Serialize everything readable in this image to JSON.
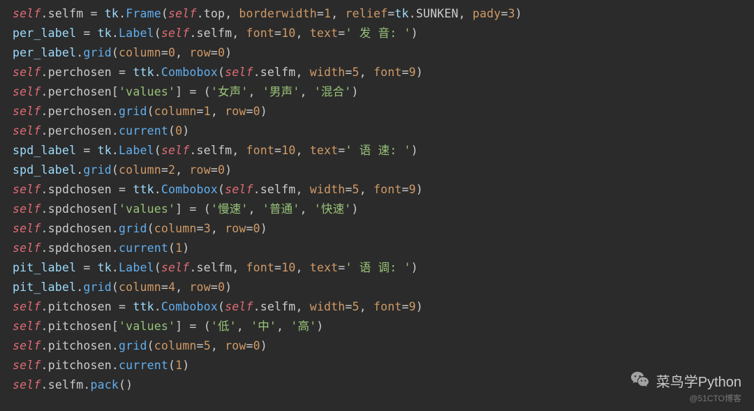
{
  "code_tokens": [
    [
      [
        "kw-self",
        "self"
      ],
      [
        "plain",
        "."
      ],
      [
        "plain",
        "selfm "
      ],
      [
        "op",
        "= "
      ],
      [
        "ident",
        "tk"
      ],
      [
        "plain",
        "."
      ],
      [
        "func",
        "Frame"
      ],
      [
        "plain",
        "("
      ],
      [
        "kw-self",
        "self"
      ],
      [
        "plain",
        "."
      ],
      [
        "plain",
        "top"
      ],
      [
        "plain",
        ", "
      ],
      [
        "gold-ident",
        "borderwidth"
      ],
      [
        "op",
        "="
      ],
      [
        "num",
        "1"
      ],
      [
        "plain",
        ", "
      ],
      [
        "gold-ident",
        "relief"
      ],
      [
        "op",
        "="
      ],
      [
        "ident",
        "tk"
      ],
      [
        "plain",
        "."
      ],
      [
        "plain",
        "SUNKEN"
      ],
      [
        "plain",
        ", "
      ],
      [
        "gold-ident",
        "pady"
      ],
      [
        "op",
        "="
      ],
      [
        "num",
        "3"
      ],
      [
        "plain",
        ")"
      ]
    ],
    [
      [
        "ident",
        "per_label "
      ],
      [
        "op",
        "= "
      ],
      [
        "ident",
        "tk"
      ],
      [
        "plain",
        "."
      ],
      [
        "func",
        "Label"
      ],
      [
        "plain",
        "("
      ],
      [
        "kw-self",
        "self"
      ],
      [
        "plain",
        "."
      ],
      [
        "plain",
        "selfm"
      ],
      [
        "plain",
        ", "
      ],
      [
        "gold-ident",
        "font"
      ],
      [
        "op",
        "="
      ],
      [
        "num",
        "10"
      ],
      [
        "plain",
        ", "
      ],
      [
        "gold-ident",
        "text"
      ],
      [
        "op",
        "="
      ],
      [
        "str",
        "' 发 音: '"
      ],
      [
        "plain",
        ")"
      ]
    ],
    [
      [
        "ident",
        "per_label"
      ],
      [
        "plain",
        "."
      ],
      [
        "func",
        "grid"
      ],
      [
        "plain",
        "("
      ],
      [
        "gold-ident",
        "column"
      ],
      [
        "op",
        "="
      ],
      [
        "num",
        "0"
      ],
      [
        "plain",
        ", "
      ],
      [
        "gold-ident",
        "row"
      ],
      [
        "op",
        "="
      ],
      [
        "num",
        "0"
      ],
      [
        "plain",
        ")"
      ]
    ],
    [
      [
        "kw-self",
        "self"
      ],
      [
        "plain",
        "."
      ],
      [
        "plain",
        "perchosen "
      ],
      [
        "op",
        "= "
      ],
      [
        "ident",
        "ttk"
      ],
      [
        "plain",
        "."
      ],
      [
        "func",
        "Combobox"
      ],
      [
        "plain",
        "("
      ],
      [
        "kw-self",
        "self"
      ],
      [
        "plain",
        "."
      ],
      [
        "plain",
        "selfm"
      ],
      [
        "plain",
        ", "
      ],
      [
        "gold-ident",
        "width"
      ],
      [
        "op",
        "="
      ],
      [
        "num",
        "5"
      ],
      [
        "plain",
        ", "
      ],
      [
        "gold-ident",
        "font"
      ],
      [
        "op",
        "="
      ],
      [
        "num",
        "9"
      ],
      [
        "plain",
        ")"
      ]
    ],
    [
      [
        "kw-self",
        "self"
      ],
      [
        "plain",
        "."
      ],
      [
        "plain",
        "perchosen"
      ],
      [
        "plain",
        "["
      ],
      [
        "str",
        "'values'"
      ],
      [
        "plain",
        "] "
      ],
      [
        "op",
        "= "
      ],
      [
        "plain",
        "("
      ],
      [
        "str",
        "'女声'"
      ],
      [
        "plain",
        ", "
      ],
      [
        "str",
        "'男声'"
      ],
      [
        "plain",
        ", "
      ],
      [
        "str",
        "'混合'"
      ],
      [
        "plain",
        ")"
      ]
    ],
    [
      [
        "kw-self",
        "self"
      ],
      [
        "plain",
        "."
      ],
      [
        "plain",
        "perchosen"
      ],
      [
        "plain",
        "."
      ],
      [
        "func",
        "grid"
      ],
      [
        "plain",
        "("
      ],
      [
        "gold-ident",
        "column"
      ],
      [
        "op",
        "="
      ],
      [
        "num",
        "1"
      ],
      [
        "plain",
        ", "
      ],
      [
        "gold-ident",
        "row"
      ],
      [
        "op",
        "="
      ],
      [
        "num",
        "0"
      ],
      [
        "plain",
        ")"
      ]
    ],
    [
      [
        "kw-self",
        "self"
      ],
      [
        "plain",
        "."
      ],
      [
        "plain",
        "perchosen"
      ],
      [
        "plain",
        "."
      ],
      [
        "func",
        "current"
      ],
      [
        "plain",
        "("
      ],
      [
        "num",
        "0"
      ],
      [
        "plain",
        ")"
      ]
    ],
    [
      [
        "ident",
        "spd_label "
      ],
      [
        "op",
        "= "
      ],
      [
        "ident",
        "tk"
      ],
      [
        "plain",
        "."
      ],
      [
        "func",
        "Label"
      ],
      [
        "plain",
        "("
      ],
      [
        "kw-self",
        "self"
      ],
      [
        "plain",
        "."
      ],
      [
        "plain",
        "selfm"
      ],
      [
        "plain",
        ", "
      ],
      [
        "gold-ident",
        "font"
      ],
      [
        "op",
        "="
      ],
      [
        "num",
        "10"
      ],
      [
        "plain",
        ", "
      ],
      [
        "gold-ident",
        "text"
      ],
      [
        "op",
        "="
      ],
      [
        "str",
        "' 语 速: '"
      ],
      [
        "plain",
        ")"
      ]
    ],
    [
      [
        "ident",
        "spd_label"
      ],
      [
        "plain",
        "."
      ],
      [
        "func",
        "grid"
      ],
      [
        "plain",
        "("
      ],
      [
        "gold-ident",
        "column"
      ],
      [
        "op",
        "="
      ],
      [
        "num",
        "2"
      ],
      [
        "plain",
        ", "
      ],
      [
        "gold-ident",
        "row"
      ],
      [
        "op",
        "="
      ],
      [
        "num",
        "0"
      ],
      [
        "plain",
        ")"
      ]
    ],
    [
      [
        "kw-self",
        "self"
      ],
      [
        "plain",
        "."
      ],
      [
        "plain",
        "spdchosen "
      ],
      [
        "op",
        "= "
      ],
      [
        "ident",
        "ttk"
      ],
      [
        "plain",
        "."
      ],
      [
        "func",
        "Combobox"
      ],
      [
        "plain",
        "("
      ],
      [
        "kw-self",
        "self"
      ],
      [
        "plain",
        "."
      ],
      [
        "plain",
        "selfm"
      ],
      [
        "plain",
        ", "
      ],
      [
        "gold-ident",
        "width"
      ],
      [
        "op",
        "="
      ],
      [
        "num",
        "5"
      ],
      [
        "plain",
        ", "
      ],
      [
        "gold-ident",
        "font"
      ],
      [
        "op",
        "="
      ],
      [
        "num",
        "9"
      ],
      [
        "plain",
        ")"
      ]
    ],
    [
      [
        "kw-self",
        "self"
      ],
      [
        "plain",
        "."
      ],
      [
        "plain",
        "spdchosen"
      ],
      [
        "plain",
        "["
      ],
      [
        "str",
        "'values'"
      ],
      [
        "plain",
        "] "
      ],
      [
        "op",
        "= "
      ],
      [
        "plain",
        "("
      ],
      [
        "str",
        "'慢速'"
      ],
      [
        "plain",
        ", "
      ],
      [
        "str",
        "'普通'"
      ],
      [
        "plain",
        ", "
      ],
      [
        "str",
        "'快速'"
      ],
      [
        "plain",
        ")"
      ]
    ],
    [
      [
        "kw-self",
        "self"
      ],
      [
        "plain",
        "."
      ],
      [
        "plain",
        "spdchosen"
      ],
      [
        "plain",
        "."
      ],
      [
        "func",
        "grid"
      ],
      [
        "plain",
        "("
      ],
      [
        "gold-ident",
        "column"
      ],
      [
        "op",
        "="
      ],
      [
        "num",
        "3"
      ],
      [
        "plain",
        ", "
      ],
      [
        "gold-ident",
        "row"
      ],
      [
        "op",
        "="
      ],
      [
        "num",
        "0"
      ],
      [
        "plain",
        ")"
      ]
    ],
    [
      [
        "kw-self",
        "self"
      ],
      [
        "plain",
        "."
      ],
      [
        "plain",
        "spdchosen"
      ],
      [
        "plain",
        "."
      ],
      [
        "func",
        "current"
      ],
      [
        "plain",
        "("
      ],
      [
        "num",
        "1"
      ],
      [
        "plain",
        ")"
      ]
    ],
    [
      [
        "ident",
        "pit_label "
      ],
      [
        "op",
        "= "
      ],
      [
        "ident",
        "tk"
      ],
      [
        "plain",
        "."
      ],
      [
        "func",
        "Label"
      ],
      [
        "plain",
        "("
      ],
      [
        "kw-self",
        "self"
      ],
      [
        "plain",
        "."
      ],
      [
        "plain",
        "selfm"
      ],
      [
        "plain",
        ", "
      ],
      [
        "gold-ident",
        "font"
      ],
      [
        "op",
        "="
      ],
      [
        "num",
        "10"
      ],
      [
        "plain",
        ", "
      ],
      [
        "gold-ident",
        "text"
      ],
      [
        "op",
        "="
      ],
      [
        "str",
        "' 语 调: '"
      ],
      [
        "plain",
        ")"
      ]
    ],
    [
      [
        "ident",
        "pit_label"
      ],
      [
        "plain",
        "."
      ],
      [
        "func",
        "grid"
      ],
      [
        "plain",
        "("
      ],
      [
        "gold-ident",
        "column"
      ],
      [
        "op",
        "="
      ],
      [
        "num",
        "4"
      ],
      [
        "plain",
        ", "
      ],
      [
        "gold-ident",
        "row"
      ],
      [
        "op",
        "="
      ],
      [
        "num",
        "0"
      ],
      [
        "plain",
        ")"
      ]
    ],
    [
      [
        "kw-self",
        "self"
      ],
      [
        "plain",
        "."
      ],
      [
        "plain",
        "pitchosen "
      ],
      [
        "op",
        "= "
      ],
      [
        "ident",
        "ttk"
      ],
      [
        "plain",
        "."
      ],
      [
        "func",
        "Combobox"
      ],
      [
        "plain",
        "("
      ],
      [
        "kw-self",
        "self"
      ],
      [
        "plain",
        "."
      ],
      [
        "plain",
        "selfm"
      ],
      [
        "plain",
        ", "
      ],
      [
        "gold-ident",
        "width"
      ],
      [
        "op",
        "="
      ],
      [
        "num",
        "5"
      ],
      [
        "plain",
        ", "
      ],
      [
        "gold-ident",
        "font"
      ],
      [
        "op",
        "="
      ],
      [
        "num",
        "9"
      ],
      [
        "plain",
        ")"
      ]
    ],
    [
      [
        "kw-self",
        "self"
      ],
      [
        "plain",
        "."
      ],
      [
        "plain",
        "pitchosen"
      ],
      [
        "plain",
        "["
      ],
      [
        "str",
        "'values'"
      ],
      [
        "plain",
        "] "
      ],
      [
        "op",
        "= "
      ],
      [
        "plain",
        "("
      ],
      [
        "str",
        "'低'"
      ],
      [
        "plain",
        ", "
      ],
      [
        "str",
        "'中'"
      ],
      [
        "plain",
        ", "
      ],
      [
        "str",
        "'高'"
      ],
      [
        "plain",
        ")"
      ]
    ],
    [
      [
        "kw-self",
        "self"
      ],
      [
        "plain",
        "."
      ],
      [
        "plain",
        "pitchosen"
      ],
      [
        "plain",
        "."
      ],
      [
        "func",
        "grid"
      ],
      [
        "plain",
        "("
      ],
      [
        "gold-ident",
        "column"
      ],
      [
        "op",
        "="
      ],
      [
        "num",
        "5"
      ],
      [
        "plain",
        ", "
      ],
      [
        "gold-ident",
        "row"
      ],
      [
        "op",
        "="
      ],
      [
        "num",
        "0"
      ],
      [
        "plain",
        ")"
      ]
    ],
    [
      [
        "kw-self",
        "self"
      ],
      [
        "plain",
        "."
      ],
      [
        "plain",
        "pitchosen"
      ],
      [
        "plain",
        "."
      ],
      [
        "func",
        "current"
      ],
      [
        "plain",
        "("
      ],
      [
        "num",
        "1"
      ],
      [
        "plain",
        ")"
      ]
    ],
    [
      [
        "kw-self",
        "self"
      ],
      [
        "plain",
        "."
      ],
      [
        "plain",
        "selfm"
      ],
      [
        "plain",
        "."
      ],
      [
        "func",
        "pack"
      ],
      [
        "plain",
        "()"
      ]
    ]
  ],
  "watermark": {
    "main": "菜鸟学Python",
    "credit": "@51CTO博客"
  }
}
